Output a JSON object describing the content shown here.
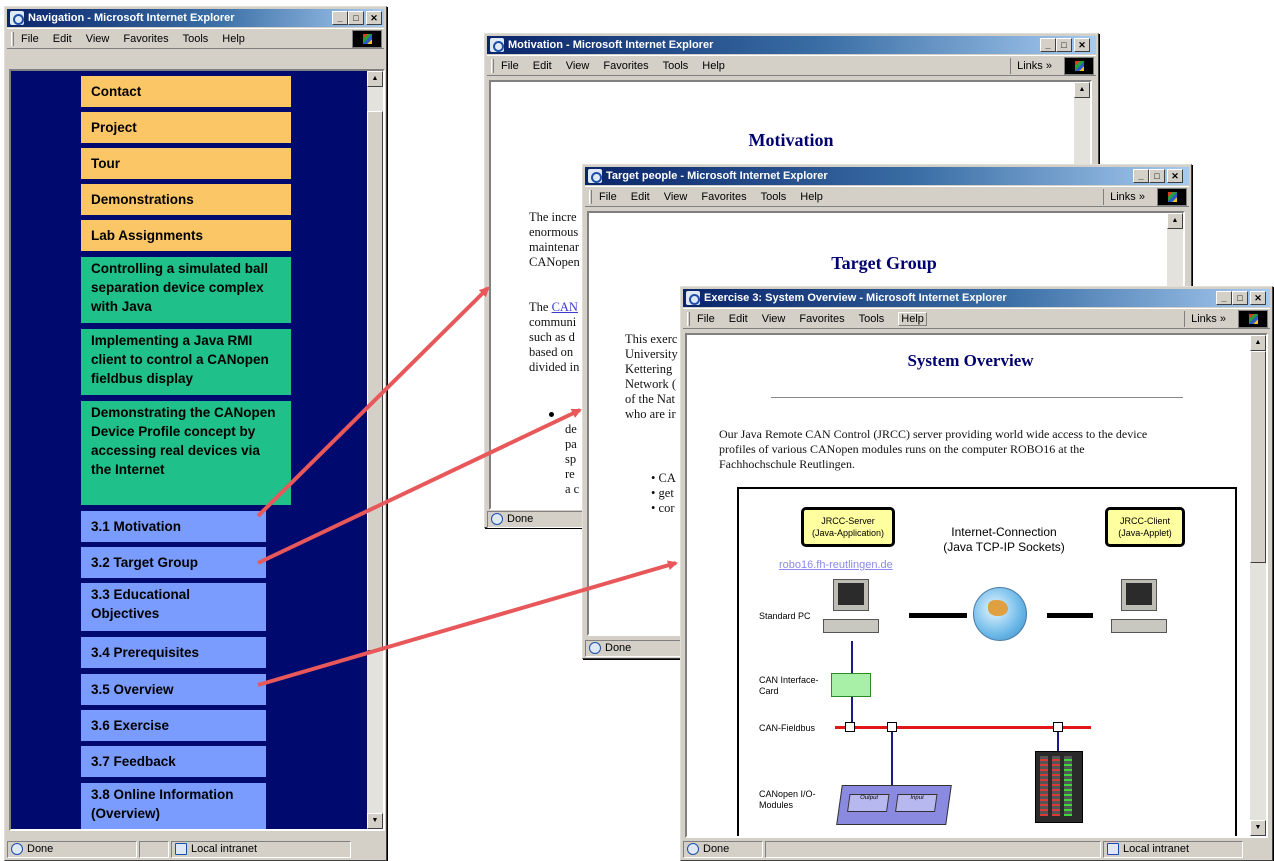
{
  "nav_window": {
    "title": "Navigation - Microsoft Internet Explorer",
    "menu": [
      "File",
      "Edit",
      "View",
      "Favorites",
      "Tools",
      "Help"
    ],
    "items_orange": [
      "Contact",
      "Project",
      "Tour",
      "Demonstrations",
      "Lab Assignments"
    ],
    "items_green": [
      "Controlling a simulated ball separation device complex with Java",
      "Implementing a Java RMI client to control a CANopen fieldbus display",
      "Demonstrating the CANopen Device Profile concept by accessing real devices via the Internet"
    ],
    "items_blue": [
      "3.1 Motivation",
      "3.2 Target Group",
      "3.3 Educational Objectives",
      "3.4 Prerequisites",
      "3.5 Overview",
      "3.6 Exercise",
      "3.7 Feedback",
      "3.8 Online Information (Overview)"
    ],
    "status": {
      "done": "Done",
      "zone": "Local intranet"
    }
  },
  "motivation_window": {
    "title": "Motivation - Microsoft Internet Explorer",
    "menu": [
      "File",
      "Edit",
      "View",
      "Favorites",
      "Tools",
      "Help"
    ],
    "links_label": "Links",
    "heading": "Motivation",
    "para1": [
      "The incre",
      "enormous",
      "maintenar",
      "CANopen"
    ],
    "para2_link": "CAN",
    "para2": [
      "The",
      "communi",
      "such as d",
      "based on",
      "divided in"
    ],
    "bullet_lines": [
      "de",
      "pa",
      "sp",
      "re",
      "a c"
    ],
    "status_done": "Done"
  },
  "target_window": {
    "title": "Target people - Microsoft Internet Explorer",
    "menu": [
      "File",
      "Edit",
      "View",
      "Favorites",
      "Tools",
      "Help"
    ],
    "links_label": "Links",
    "heading": "Target Group",
    "para": [
      "This exerc",
      "University",
      "Kettering",
      "Network (",
      "of the Nat",
      "who are ir"
    ],
    "bullets": [
      "CA",
      "get",
      "cor"
    ],
    "status_done": "Done"
  },
  "overview_window": {
    "title": "Exercise 3: System Overview - Microsoft Internet Explorer",
    "menu": [
      "File",
      "Edit",
      "View",
      "Favorites",
      "Tools",
      "Help"
    ],
    "links_label": "Links",
    "heading": "System Overview",
    "para": [
      "Our Java Remote CAN Control (JRCC) server providing world wide access to the device",
      "profiles of various CANopen modules runs on the computer ROBO16 at the",
      "Fachhochschule Reutlingen."
    ],
    "diagram": {
      "server_box": [
        "JRCC-Server",
        "(Java-Application)"
      ],
      "client_box": [
        "JRCC-Client",
        "(Java-Applet)"
      ],
      "connection_label": [
        "Internet-Connection",
        "(Java TCP-IP Sockets)"
      ],
      "host_link": "robo16.fh-reutlingen.de",
      "labels": [
        "Standard PC",
        "CAN Interface-Card",
        "CAN-Fieldbus",
        "CANopen I/O-Modules"
      ],
      "module_labels": [
        "Output",
        "Input"
      ]
    },
    "status": {
      "done": "Done",
      "zone": "Local intranet"
    }
  },
  "colors": {
    "nav_bg": "#000a6e",
    "orange": "#fbc766",
    "green": "#1fc08a",
    "blue": "#7a9cff",
    "arrow": "#e8585a"
  }
}
